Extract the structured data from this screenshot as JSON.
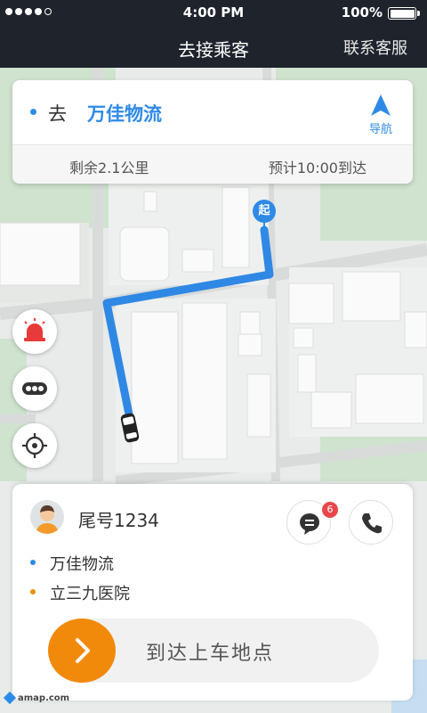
{
  "status_bar": {
    "signal_dots": 5,
    "signal_filled": 4,
    "time": "4:00 PM",
    "battery_text": "100%",
    "battery_level": 1.0
  },
  "nav": {
    "title": "去接乘客",
    "contact": "联系客服"
  },
  "destination": {
    "go": "去",
    "name": "万佳物流",
    "navigate_label": "导航",
    "remaining": "剩余2.1公里",
    "eta": "预计10:00到达"
  },
  "map": {
    "start_marker": "起",
    "route_color": "#2f88e4",
    "logo": "amap.com"
  },
  "side_buttons": [
    {
      "name": "alarm-button",
      "icon": "siren-icon"
    },
    {
      "name": "more-button",
      "icon": "more-dots-icon"
    },
    {
      "name": "locate-button",
      "icon": "locate-icon"
    }
  ],
  "passenger": {
    "name": "尾号1234",
    "unread_messages": "6",
    "pickup": "万佳物流",
    "dropoff": "立三九医院",
    "pickup_color": "#2f8ae6",
    "dropoff_color": "#e8900e"
  },
  "action": {
    "slide_label": "到达上车地点",
    "accent": "#f18a0a"
  }
}
